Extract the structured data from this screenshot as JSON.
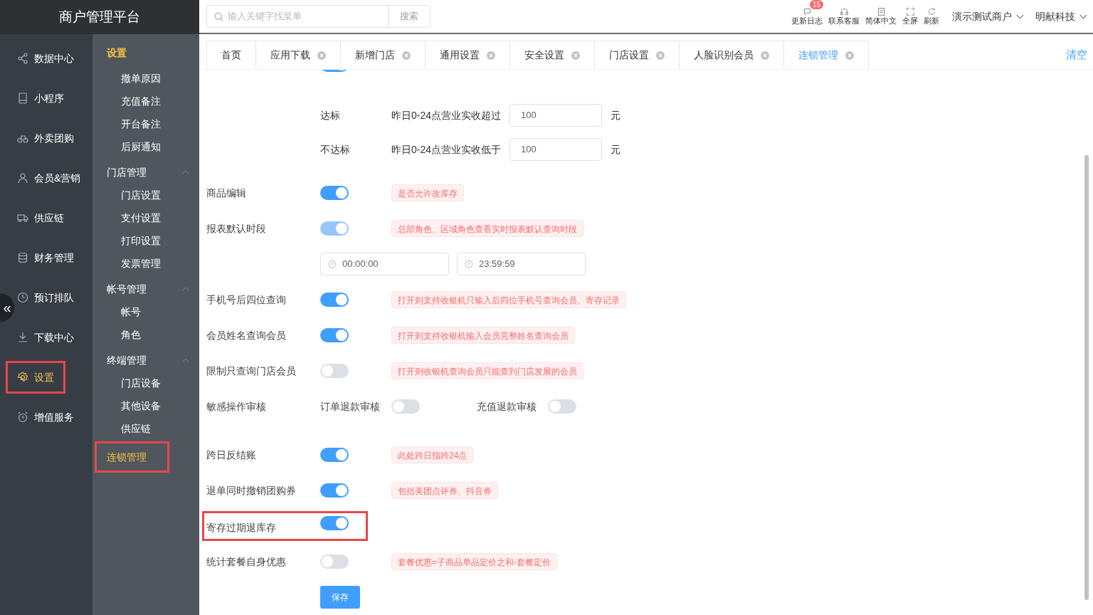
{
  "brand": "商户管理平台",
  "search": {
    "placeholder": "输入关键字找菜单",
    "button": "搜索"
  },
  "toolbar": [
    {
      "label": "更新日志",
      "badge": "15"
    },
    {
      "label": "联系客服"
    },
    {
      "label": "简体中文"
    },
    {
      "label": "全屏"
    },
    {
      "label": "刷新"
    }
  ],
  "account_menus": [
    "演示测试商户",
    "明献科技"
  ],
  "nav": [
    {
      "label": "数据中心",
      "selected": false,
      "highlighted": false
    },
    {
      "label": "小程序",
      "selected": false,
      "highlighted": false
    },
    {
      "label": "外卖团购",
      "selected": false,
      "highlighted": false
    },
    {
      "label": "会员&营销",
      "selected": false,
      "highlighted": false
    },
    {
      "label": "供应链",
      "selected": false,
      "highlighted": false
    },
    {
      "label": "财务管理",
      "selected": false,
      "highlighted": false
    },
    {
      "label": "预订排队",
      "selected": false,
      "highlighted": false
    },
    {
      "label": "下载中心",
      "selected": false,
      "highlighted": false
    },
    {
      "label": "设置",
      "selected": true,
      "highlighted": true
    },
    {
      "label": "增值服务",
      "selected": false,
      "highlighted": false
    }
  ],
  "collapse_button": "«",
  "submenu": [
    {
      "kind": "title",
      "label": "设置",
      "children": [
        {
          "label": "撤单原因"
        },
        {
          "label": "充值备注"
        },
        {
          "label": "开台备注"
        },
        {
          "label": "后厨通知"
        }
      ]
    },
    {
      "kind": "group",
      "label": "门店管理",
      "expanded": true,
      "children": [
        {
          "label": "门店设置"
        },
        {
          "label": "支付设置"
        },
        {
          "label": "打印设置"
        },
        {
          "label": "发票管理"
        }
      ]
    },
    {
      "kind": "group",
      "label": "帐号管理",
      "expanded": true,
      "children": [
        {
          "label": "帐号"
        },
        {
          "label": "角色"
        }
      ]
    },
    {
      "kind": "group",
      "label": "终端管理",
      "expanded": true,
      "children": [
        {
          "label": "门店设备"
        },
        {
          "label": "其他设备"
        },
        {
          "label": "供应链"
        }
      ]
    },
    {
      "kind": "link",
      "label": "连锁管理",
      "selected": true,
      "highlighted": true
    }
  ],
  "tabs": [
    {
      "label": "首页",
      "closable": false,
      "selected": false
    },
    {
      "label": "应用下载",
      "closable": true,
      "selected": false
    },
    {
      "label": "新增门店",
      "closable": true,
      "selected": false
    },
    {
      "label": "通用设置",
      "closable": true,
      "selected": false
    },
    {
      "label": "安全设置",
      "closable": true,
      "selected": false
    },
    {
      "label": "门店设置",
      "closable": true,
      "selected": false
    },
    {
      "label": "人脸识别会员",
      "closable": true,
      "selected": false
    },
    {
      "label": "连锁管理",
      "closable": true,
      "selected": true
    }
  ],
  "clear_tabs": "清空",
  "settings": [
    {
      "kind": "partial",
      "on": true
    },
    {
      "kind": "threshold",
      "label": "达标",
      "condition": "昨日0-24点营业实收超过",
      "value": "100",
      "unit": "元"
    },
    {
      "kind": "threshold",
      "label": "不达标",
      "condition": "昨日0-24点营业实收低于",
      "value": "100",
      "unit": "元"
    },
    {
      "kind": "switch",
      "label": "商品编辑",
      "on": true,
      "disabled": false,
      "hint": "是否允许改库存",
      "highlighted": false
    },
    {
      "kind": "switch",
      "label": "报表默认时段",
      "on": true,
      "disabled": true,
      "hint": "总部角色、区域角色查看实时报表默认查询时段",
      "highlighted": false
    },
    {
      "kind": "time_range",
      "start": "00:00:00",
      "end": "23:59:59"
    },
    {
      "kind": "switch",
      "label": "手机号后四位查询",
      "on": true,
      "disabled": false,
      "hint": "打开则支持收银机只输入后四位手机号查询会员、寄存记录",
      "highlighted": false
    },
    {
      "kind": "switch",
      "label": "会员姓名查询会员",
      "on": true,
      "disabled": false,
      "hint": "打开则支持收银机输入会员完整姓名查询会员",
      "highlighted": false
    },
    {
      "kind": "switch",
      "label": "限制只查询门店会员",
      "on": false,
      "disabled": false,
      "hint": "打开则收银机查询会员只能查到门店发展的会员",
      "highlighted": false
    },
    {
      "kind": "dual_switch",
      "label": "敏感操作审核",
      "switches": [
        {
          "label": "订单退款审核",
          "on": false
        },
        {
          "label": "充值退款审核",
          "on": false
        }
      ]
    },
    {
      "kind": "switch",
      "label": "跨日反结账",
      "on": true,
      "disabled": false,
      "hint": "此处跨日指跨24点",
      "highlighted": false
    },
    {
      "kind": "switch",
      "label": "退单同时撤销团购券",
      "on": true,
      "disabled": false,
      "hint": "包括美团点评券、抖音券",
      "highlighted": false
    },
    {
      "kind": "switch",
      "label": "寄存过期退库存",
      "on": true,
      "disabled": false,
      "highlighted": true
    },
    {
      "kind": "switch",
      "label": "统计套餐自身优惠",
      "on": false,
      "disabled": false,
      "hint": "套餐优惠=子商品单品定价之和-套餐定价",
      "highlighted": false
    },
    {
      "kind": "button",
      "label": "保存"
    }
  ]
}
